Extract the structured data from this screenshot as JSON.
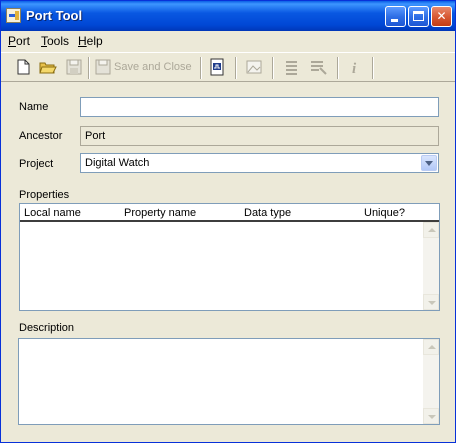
{
  "window": {
    "title": "Port Tool"
  },
  "menubar": {
    "items": [
      "Port",
      "Tools",
      "Help"
    ]
  },
  "toolbar": {
    "save_and_close_label": "Save and Close"
  },
  "form": {
    "name": {
      "label": "Name",
      "value": ""
    },
    "ancestor": {
      "label": "Ancestor",
      "value": "Port"
    },
    "project": {
      "label": "Project",
      "value": "Digital Watch"
    }
  },
  "properties": {
    "label": "Properties",
    "columns": [
      "Local name",
      "Property name",
      "Data type",
      "Unique?"
    ],
    "rows": []
  },
  "description": {
    "label": "Description",
    "value": ""
  },
  "colors": {
    "title_bar": "#0058e6",
    "window_bg": "#ece9d8",
    "field_border": "#7f9db9",
    "disabled_text": "#aca899"
  }
}
